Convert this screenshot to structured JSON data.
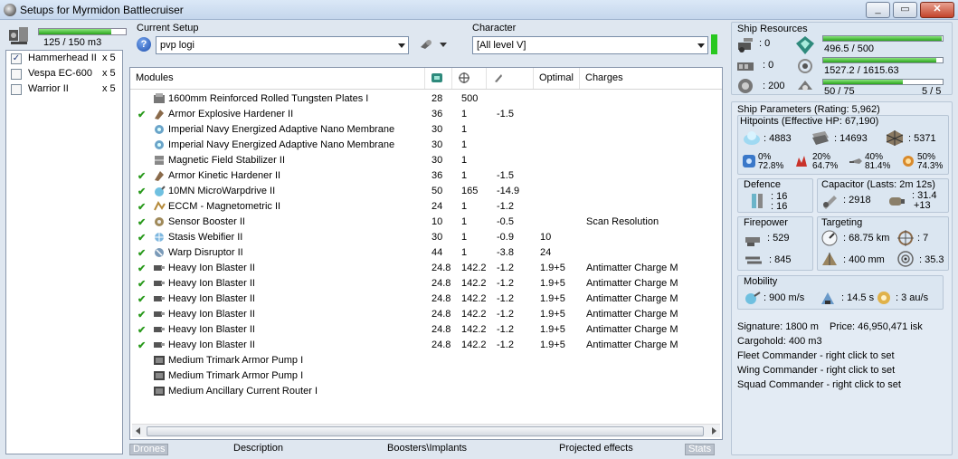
{
  "window": {
    "title": "Setups for Myrmidon Battlecruiser",
    "min": "_",
    "max": "▭",
    "close": "✕"
  },
  "drones": {
    "bay_text": "125 / 150 m3",
    "bay_fraction": 0.833,
    "items": [
      {
        "name": "Hammerhead II",
        "qty": "x 5",
        "checked": true
      },
      {
        "name": "Vespa EC-600",
        "qty": "x 5",
        "checked": false
      },
      {
        "name": "Warrior II",
        "qty": "x 5",
        "checked": false
      }
    ]
  },
  "setup": {
    "label": "Current Setup",
    "value": "pvp logi"
  },
  "character": {
    "label": "Character",
    "value": "[All level V]"
  },
  "modules": {
    "headers": {
      "modules": "Modules",
      "optimal": "Optimal",
      "charges": "Charges"
    },
    "rows": [
      {
        "active": false,
        "name": "1600mm Reinforced Rolled Tungsten Plates I",
        "cpu": "28",
        "pg": "500",
        "cap": "",
        "optimal": "",
        "charges": "",
        "icon": "armor-plate-icon"
      },
      {
        "active": true,
        "name": "Armor Explosive Hardener II",
        "cpu": "36",
        "pg": "1",
        "cap": "-1.5",
        "optimal": "",
        "charges": "",
        "icon": "hardener-icon"
      },
      {
        "active": false,
        "name": "Imperial Navy Energized Adaptive Nano Membrane",
        "cpu": "30",
        "pg": "1",
        "cap": "",
        "optimal": "",
        "charges": "",
        "icon": "membrane-icon"
      },
      {
        "active": false,
        "name": "Imperial Navy Energized Adaptive Nano Membrane",
        "cpu": "30",
        "pg": "1",
        "cap": "",
        "optimal": "",
        "charges": "",
        "icon": "membrane-icon"
      },
      {
        "active": false,
        "name": "Magnetic Field Stabilizer II",
        "cpu": "30",
        "pg": "1",
        "cap": "",
        "optimal": "",
        "charges": "",
        "icon": "stabilizer-icon"
      },
      {
        "active": true,
        "name": "Armor Kinetic Hardener II",
        "cpu": "36",
        "pg": "1",
        "cap": "-1.5",
        "optimal": "",
        "charges": "",
        "icon": "hardener-icon"
      },
      {
        "active": true,
        "name": "10MN MicroWarpdrive II",
        "cpu": "50",
        "pg": "165",
        "cap": "-14.9",
        "optimal": "",
        "charges": "",
        "icon": "mwd-icon"
      },
      {
        "active": true,
        "name": "ECCM - Magnetometric II",
        "cpu": "24",
        "pg": "1",
        "cap": "-1.2",
        "optimal": "",
        "charges": "",
        "icon": "eccm-icon"
      },
      {
        "active": true,
        "name": "Sensor Booster II",
        "cpu": "10",
        "pg": "1",
        "cap": "-0.5",
        "optimal": "",
        "charges": "Scan Resolution",
        "icon": "sensor-booster-icon"
      },
      {
        "active": true,
        "name": "Stasis Webifier II",
        "cpu": "30",
        "pg": "1",
        "cap": "-0.9",
        "optimal": "10",
        "charges": "",
        "icon": "webifier-icon"
      },
      {
        "active": true,
        "name": "Warp Disruptor II",
        "cpu": "44",
        "pg": "1",
        "cap": "-3.8",
        "optimal": "24",
        "charges": "",
        "icon": "disruptor-icon"
      },
      {
        "active": true,
        "name": "Heavy Ion Blaster II",
        "cpu": "24.8",
        "pg": "142.2",
        "cap": "-1.2",
        "optimal": "1.9+5",
        "charges": "Antimatter Charge M",
        "icon": "blaster-icon"
      },
      {
        "active": true,
        "name": "Heavy Ion Blaster II",
        "cpu": "24.8",
        "pg": "142.2",
        "cap": "-1.2",
        "optimal": "1.9+5",
        "charges": "Antimatter Charge M",
        "icon": "blaster-icon"
      },
      {
        "active": true,
        "name": "Heavy Ion Blaster II",
        "cpu": "24.8",
        "pg": "142.2",
        "cap": "-1.2",
        "optimal": "1.9+5",
        "charges": "Antimatter Charge M",
        "icon": "blaster-icon"
      },
      {
        "active": true,
        "name": "Heavy Ion Blaster II",
        "cpu": "24.8",
        "pg": "142.2",
        "cap": "-1.2",
        "optimal": "1.9+5",
        "charges": "Antimatter Charge M",
        "icon": "blaster-icon"
      },
      {
        "active": true,
        "name": "Heavy Ion Blaster II",
        "cpu": "24.8",
        "pg": "142.2",
        "cap": "-1.2",
        "optimal": "1.9+5",
        "charges": "Antimatter Charge M",
        "icon": "blaster-icon"
      },
      {
        "active": true,
        "name": "Heavy Ion Blaster II",
        "cpu": "24.8",
        "pg": "142.2",
        "cap": "-1.2",
        "optimal": "1.9+5",
        "charges": "Antimatter Charge M",
        "icon": "blaster-icon"
      },
      {
        "active": false,
        "name": "Medium Trimark Armor Pump I",
        "cpu": "",
        "pg": "",
        "cap": "",
        "optimal": "",
        "charges": "",
        "icon": "rig-icon"
      },
      {
        "active": false,
        "name": "Medium Trimark Armor Pump I",
        "cpu": "",
        "pg": "",
        "cap": "",
        "optimal": "",
        "charges": "",
        "icon": "rig-icon"
      },
      {
        "active": false,
        "name": "Medium Ancillary Current Router I",
        "cpu": "",
        "pg": "",
        "cap": "",
        "optimal": "",
        "charges": "",
        "icon": "rig-icon"
      }
    ]
  },
  "tabs": {
    "drones": "Drones",
    "description": "Description",
    "boosters": "Boosters\\Implants",
    "projected": "Projected effects",
    "stats": "Stats"
  },
  "resources": {
    "label": "Ship Resources",
    "hardpoints": {
      "turrets": ": 0",
      "launchers": ": 0",
      "calibration": ": 200"
    },
    "cpu": {
      "text": "496.5 / 500",
      "fraction": 0.993
    },
    "powergrid": {
      "text": "1527.2 / 1615.63",
      "fraction": 0.945
    },
    "drone_bandwidth": {
      "text": "50 / 75",
      "fraction": 0.667,
      "drones_text": "5 / 5"
    }
  },
  "params": {
    "label": "Ship Parameters (Rating: 5,962)",
    "hitpoints": {
      "label": "Hitpoints (Effective HP: 67,190)",
      "shield": ": 4883",
      "armor": ": 14693",
      "structure": ": 5371",
      "resists": [
        {
          "top": "0%",
          "bottom": "72.8%"
        },
        {
          "top": "20%",
          "bottom": "64.7%"
        },
        {
          "top": "40%",
          "bottom": "81.4%"
        },
        {
          "top": "50%",
          "bottom": "74.3%"
        }
      ]
    },
    "defence": {
      "label": "Defence",
      "line1": ": 16",
      "line2": ": 16"
    },
    "capacitor": {
      "label": "Capacitor (Lasts: 2m 12s)",
      "capacity": ": 2918",
      "recharge1": ": 31.4",
      "recharge2": "+13"
    },
    "firepower": {
      "label": "Firepower",
      "turret": ": 529",
      "drone": ": 845"
    },
    "targeting": {
      "label": "Targeting",
      "range": ": 68.75 km",
      "targets": ": 7",
      "sigres": ": 400 mm",
      "sensor": ": 35.3"
    },
    "mobility": {
      "label": "Mobility",
      "velocity": ": 900 m/s",
      "align": ": 14.5 s",
      "warp": ": 3 au/s"
    },
    "signature": "Signature: 1800 m",
    "price": "Price: 46,950,471 isk",
    "cargohold": "Cargohold: 400 m3",
    "fleet": "Fleet Commander - right click to set",
    "wing": "Wing Commander - right click to set",
    "squad": "Squad Commander - right click to set"
  }
}
